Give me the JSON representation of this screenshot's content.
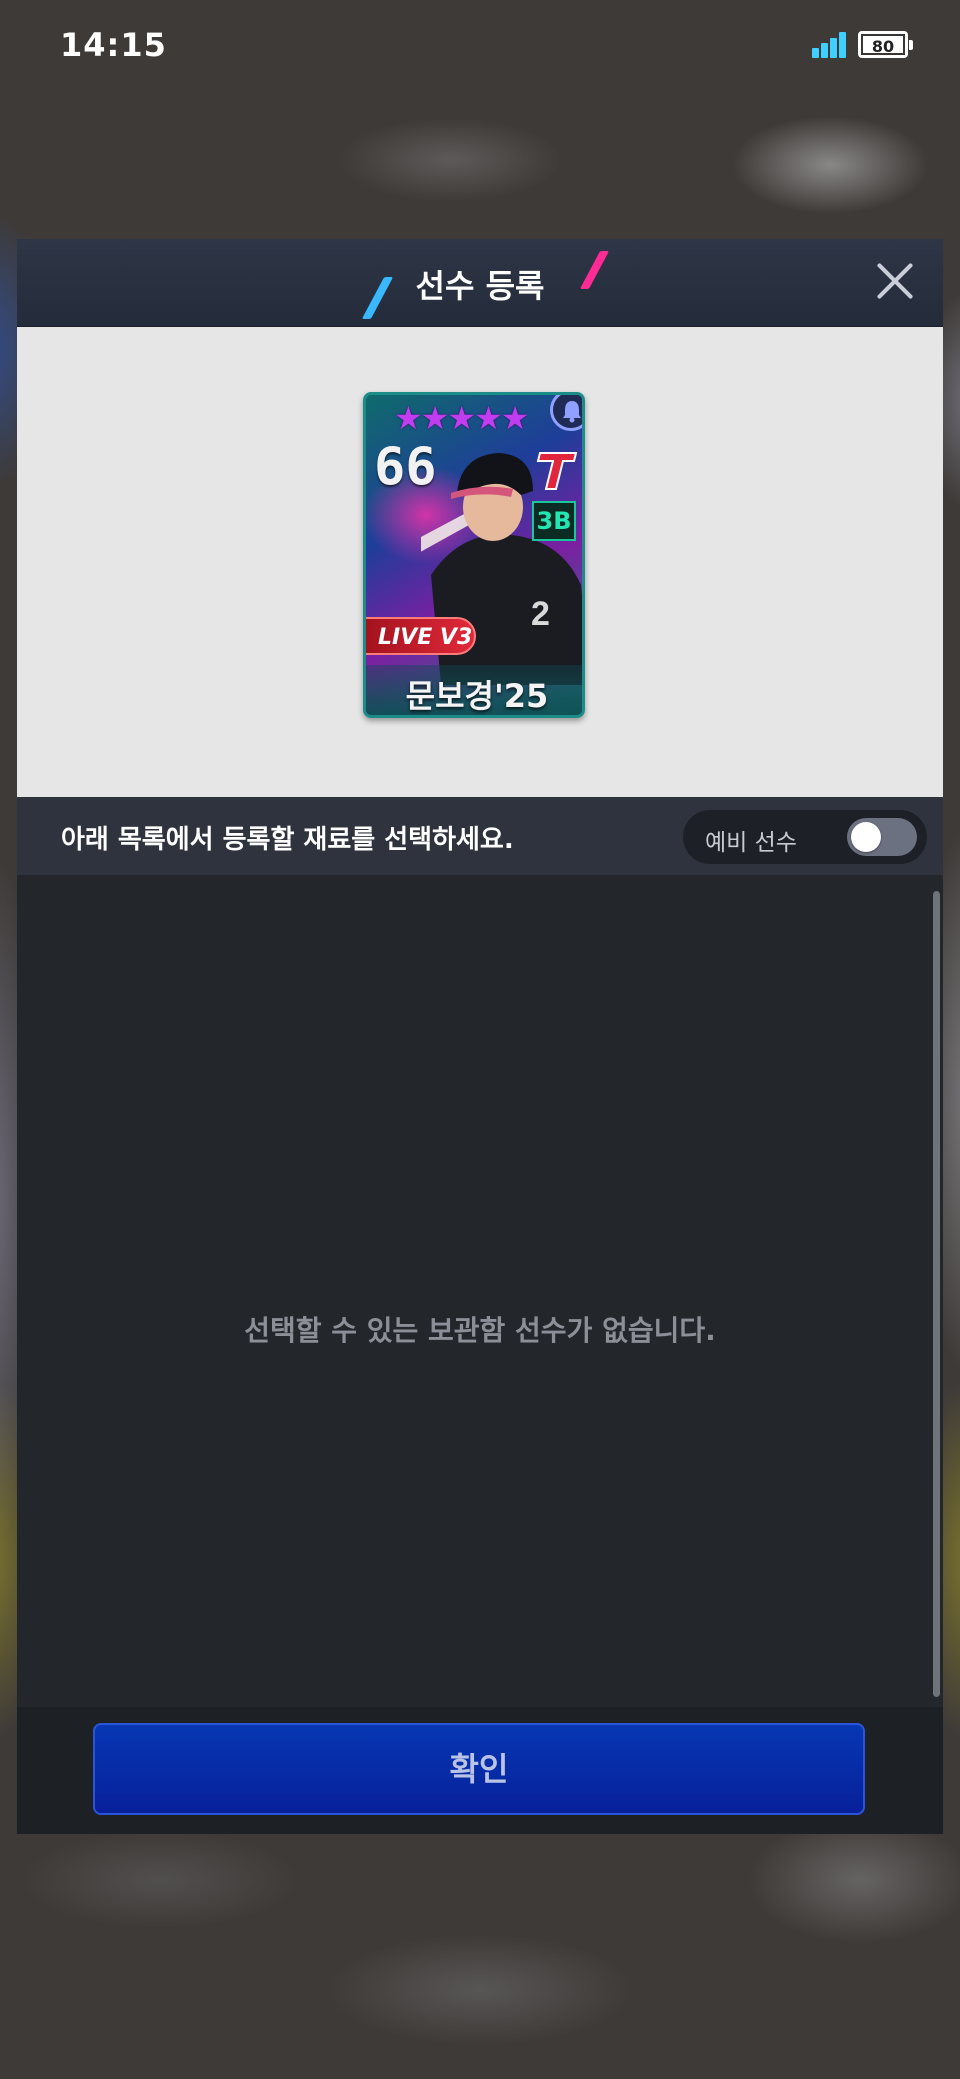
{
  "status_bar": {
    "time": "14:15",
    "battery_level": "80"
  },
  "modal": {
    "title": "선수 등록",
    "accent_colors": {
      "left_slash": "#39b7ff",
      "right_slash": "#ff2b94"
    },
    "close_icon": "close-icon"
  },
  "player_card": {
    "stars": 5,
    "overall": "66",
    "position": "3B",
    "edition": "LIVE V3",
    "name": "문보경'25",
    "team_logo": "T"
  },
  "instruction": {
    "text": "아래 목록에서 등록할 재료를 선택하세요.",
    "toggle_label": "예비 선수",
    "toggle_on": false
  },
  "list": {
    "empty_message": "선택할 수 있는 보관함 선수가 없습니다."
  },
  "footer": {
    "confirm_label": "확인"
  }
}
